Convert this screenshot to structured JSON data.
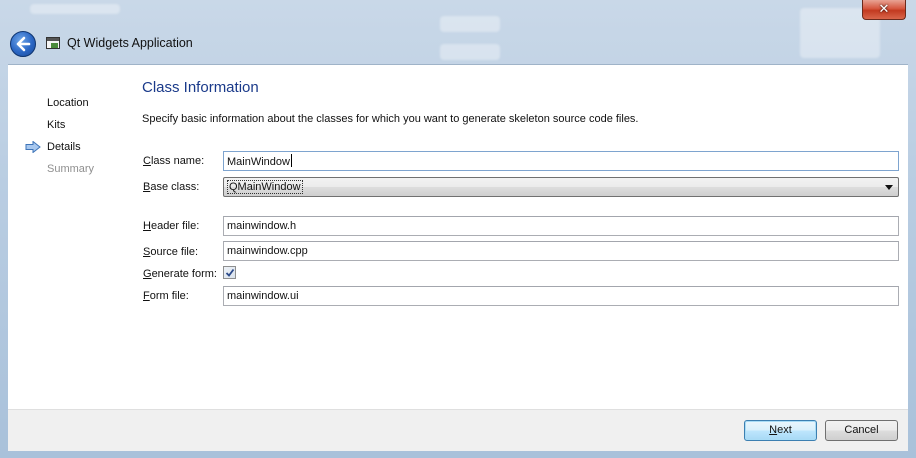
{
  "window": {
    "title": "Qt Widgets Application",
    "close_label": "✕"
  },
  "sidebar": {
    "items": [
      {
        "label": "Location",
        "state": "done"
      },
      {
        "label": "Kits",
        "state": "done"
      },
      {
        "label": "Details",
        "state": "current"
      },
      {
        "label": "Summary",
        "state": "pending"
      }
    ]
  },
  "page": {
    "title": "Class Information",
    "description": "Specify basic information about the classes for which you want to generate skeleton source code files."
  },
  "form": {
    "class_name": {
      "label_key": "C",
      "label_rest": "lass name:",
      "value": "MainWindow"
    },
    "base_class": {
      "label_key": "B",
      "label_rest": "ase class:",
      "value": "QMainWindow"
    },
    "header_file": {
      "label_key": "H",
      "label_rest": "eader file:",
      "value": "mainwindow.h"
    },
    "source_file": {
      "label_key": "S",
      "label_rest": "ource file:",
      "value": "mainwindow.cpp"
    },
    "generate_form": {
      "label_key": "G",
      "label_rest": "enerate form:",
      "checked": true
    },
    "form_file": {
      "label_key": "F",
      "label_rest": "orm file:",
      "value": "mainwindow.ui"
    }
  },
  "buttons": {
    "next_key": "N",
    "next_rest": "ext",
    "cancel": "Cancel"
  },
  "icons": {
    "back": "back-arrow-icon",
    "app": "window-app-icon",
    "current_step": "right-arrow-icon",
    "dropdown": "chevron-down-icon",
    "check": "checkmark-icon",
    "close": "close-icon"
  },
  "colors": {
    "title_blue": "#1a3a8a",
    "accent_blue": "#3c7fb1",
    "close_red": "#c23a20"
  }
}
